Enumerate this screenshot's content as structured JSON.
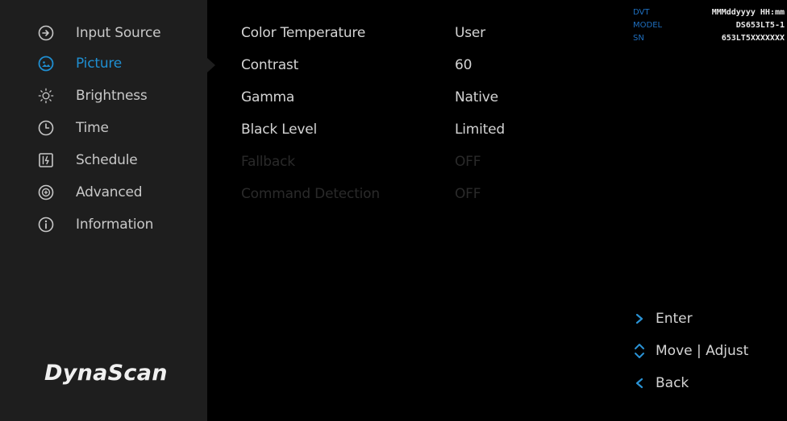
{
  "sidebar": {
    "items": [
      {
        "label": "Input Source",
        "icon": "input-source-icon",
        "selected": false
      },
      {
        "label": "Picture",
        "icon": "picture-icon",
        "selected": true
      },
      {
        "label": "Brightness",
        "icon": "brightness-icon",
        "selected": false
      },
      {
        "label": "Time",
        "icon": "clock-icon",
        "selected": false
      },
      {
        "label": "Schedule",
        "icon": "schedule-icon",
        "selected": false
      },
      {
        "label": "Advanced",
        "icon": "advanced-icon",
        "selected": false
      },
      {
        "label": "Information",
        "icon": "info-icon",
        "selected": false
      }
    ],
    "brand": "DynaScan"
  },
  "settings": [
    {
      "label": "Color Temperature",
      "value": "User",
      "enabled": true
    },
    {
      "label": "Contrast",
      "value": "60",
      "enabled": true
    },
    {
      "label": "Gamma",
      "value": "Native",
      "enabled": true
    },
    {
      "label": "Black Level",
      "value": "Limited",
      "enabled": true
    },
    {
      "label": "Fallback",
      "value": "OFF",
      "enabled": false
    },
    {
      "label": "Command Detection",
      "value": "OFF",
      "enabled": false
    }
  ],
  "info": {
    "dvt_key": "DVT",
    "dvt_value": "MMMddyyyy HH:mm",
    "model_key": "MODEL",
    "model_value": "DS653LT5-1",
    "sn_key": "SN",
    "sn_value": "653LT5XXXXXXX"
  },
  "hints": {
    "enter_label": "Enter",
    "move_adjust_label": "Move | Adjust",
    "back_label": "Back"
  },
  "colors": {
    "accent": "#1f8fd2",
    "sidebar_bg": "#1e1e1e",
    "background": "#000000"
  }
}
